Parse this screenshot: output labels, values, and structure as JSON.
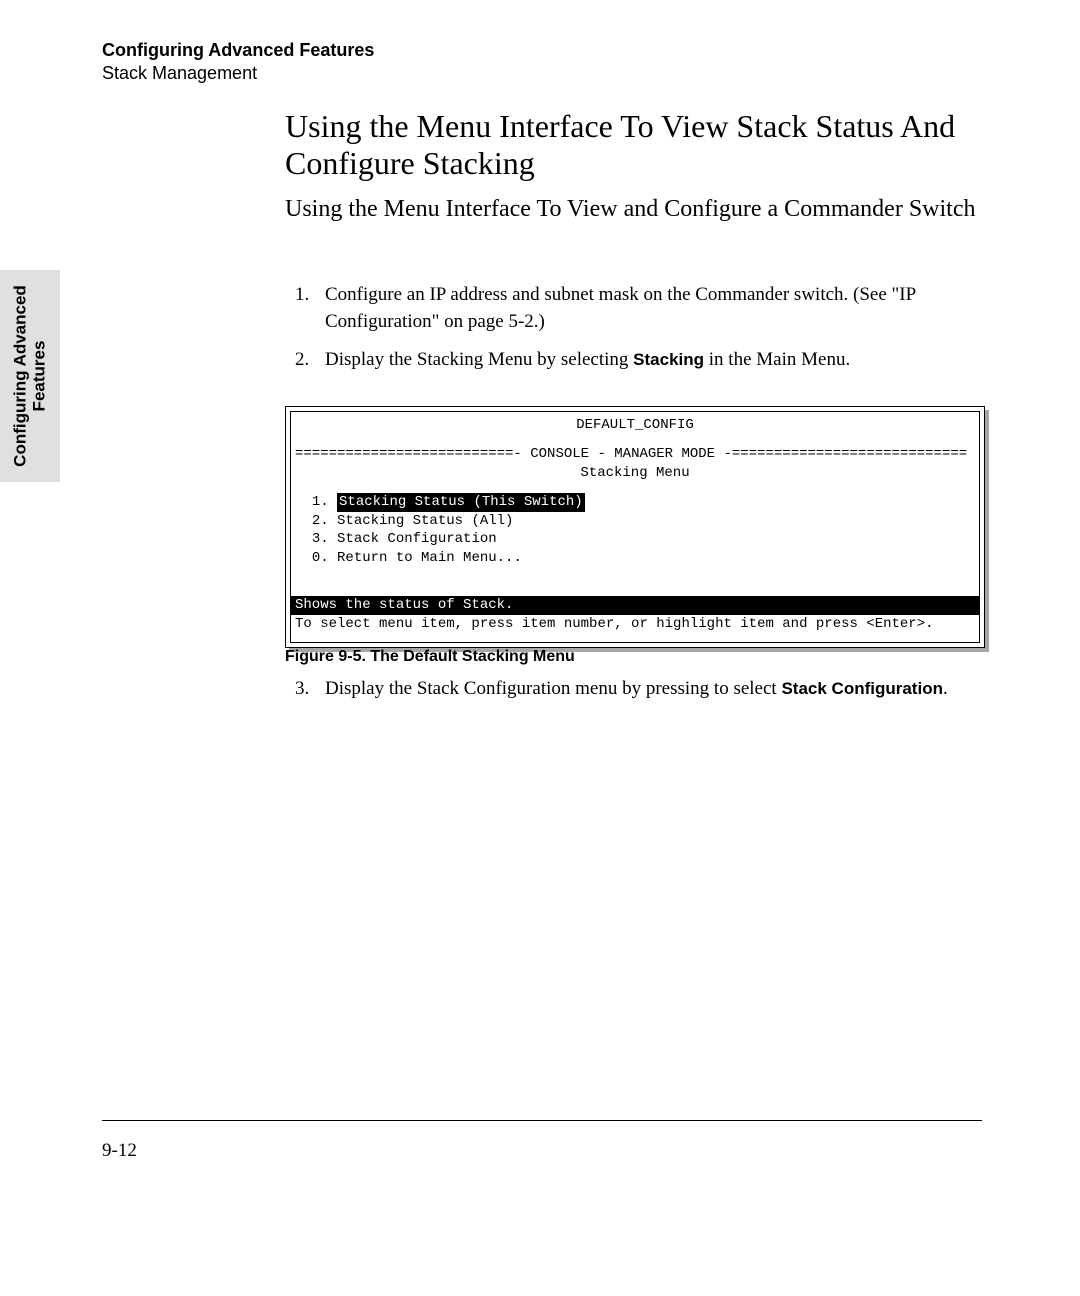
{
  "sideTab": {
    "line1": "Configuring Advanced",
    "line2": "Features"
  },
  "header": {
    "title": "Configuring Advanced Features",
    "subtitle": "Stack Management"
  },
  "h1": "Using the Menu Interface To View Stack Status And Configure Stacking",
  "h2": "Using the Menu Interface To View and Configure a Commander Switch",
  "steps": {
    "s1": {
      "num": "1.",
      "text": "Configure an IP address and subnet mask on the Commander switch. (See \"IP Configuration\" on page 5-2.)"
    },
    "s2": {
      "num": "2.",
      "pre": "Display the Stacking Menu by selecting ",
      "bold": "Stacking",
      "post": " in the Main Menu."
    },
    "s3": {
      "num": "3.",
      "pre": "Display the Stack Configuration menu by pressing      to select ",
      "bold1": "Stack Configuration",
      "post1": "."
    }
  },
  "figCaption": "Figure 9-5.  The Default Stacking Menu",
  "pageNumber": "9-12",
  "terminal": {
    "title": "DEFAULT_CONFIG",
    "ruleLeft": "==========================- ",
    "ruleMid": "CONSOLE - MANAGER MODE",
    "ruleRight": " -============================",
    "submenu": "Stacking Menu",
    "items": {
      "i1": {
        "num": "1.",
        "label": "Stacking Status (This Switch)"
      },
      "i2": "2. Stacking Status (All)",
      "i3": "3. Stack Configuration",
      "i0": "0. Return to Main Menu..."
    },
    "statusBar": "Shows the status of Stack.",
    "hint": "To select menu item, press item number, or highlight item and press <Enter>."
  }
}
